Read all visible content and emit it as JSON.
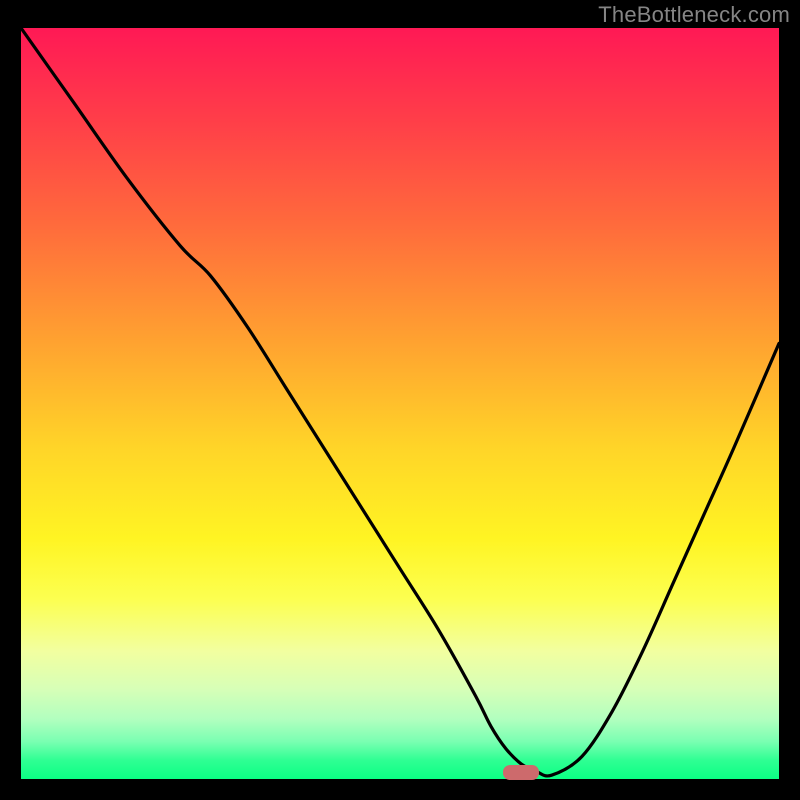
{
  "watermark": "TheBottleneck.com",
  "chart_data": {
    "type": "line",
    "title": "",
    "xlabel": "",
    "ylabel": "",
    "xlim": [
      0,
      100
    ],
    "ylim": [
      0,
      100
    ],
    "x": [
      0,
      7,
      14,
      21,
      25,
      30,
      35,
      40,
      45,
      50,
      55,
      60,
      62,
      64,
      66,
      68,
      70,
      74,
      78,
      82,
      86,
      90,
      94,
      100
    ],
    "values": [
      100,
      90,
      80,
      71,
      67,
      60,
      52,
      44,
      36,
      28,
      20,
      11,
      7,
      4,
      2,
      1,
      0.5,
      3,
      9,
      17,
      26,
      35,
      44,
      58
    ],
    "series": [
      {
        "name": "bottleneck-curve",
        "color": "#000000"
      }
    ],
    "optimal_marker": {
      "x": 66,
      "y": 0.5
    },
    "background_gradient": [
      "#ff1955",
      "#0bff84"
    ]
  }
}
